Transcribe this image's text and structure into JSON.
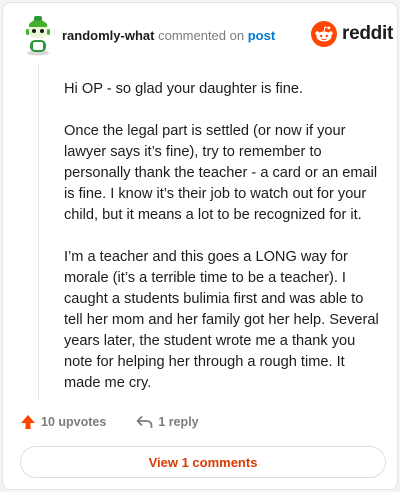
{
  "comment": {
    "username": "randomly-what",
    "commented_on": "commented on",
    "post_link": "post",
    "paragraphs": [
      "Hi OP - so glad your daughter is fine.",
      "Once the legal part is settled (or now if your lawyer says it’s fine), try to remember to personally thank the teacher - a card or an email is fine. I know it’s their job to watch out for your child, but it means a lot to be recognized for it.",
      "I’m a teacher and this goes a LONG way for morale (it’s a terrible time to be a teacher). I caught a students bulimia first and was able to tell her mom and her family got her help. Several years later, the student wrote me a thank you note for helping her through a rough time. It made me cry."
    ]
  },
  "brand": {
    "wordmark": "reddit",
    "icon": "reddit-snoo-icon",
    "color": "#ff4500"
  },
  "actions": {
    "upvotes": "10 upvotes",
    "replies": "1 reply",
    "view_comments": "View 1 comments"
  },
  "colors": {
    "accent": "#d93a00",
    "link": "#0079d3",
    "upvote": "#ff4500"
  }
}
